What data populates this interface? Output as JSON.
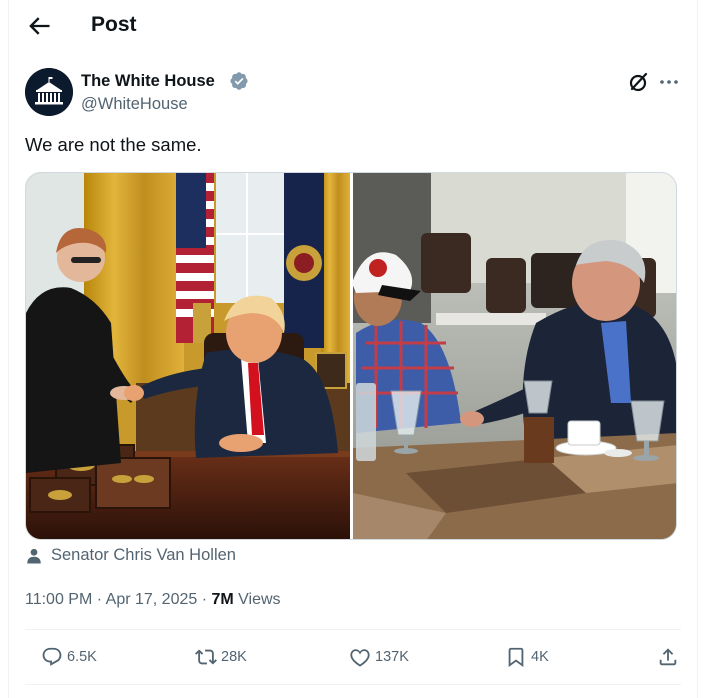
{
  "header": {
    "title": "Post",
    "back_icon": "arrow-left-icon"
  },
  "author": {
    "name": "The White House",
    "handle": "@WhiteHouse",
    "verified_icon": "verified-badge-icon",
    "verified_color": "#829aab"
  },
  "post": {
    "text": "We are not the same."
  },
  "media": {
    "images": [
      {
        "kind": "photo",
        "icon": "photo-oval-office"
      },
      {
        "kind": "photo",
        "icon": "photo-restaurant-meeting"
      }
    ]
  },
  "tag": {
    "icon": "person-icon",
    "text": "Senator Chris Van Hollen"
  },
  "meta": {
    "time": "11:00 PM",
    "sep1": " · ",
    "date": "Apr 17, 2025",
    "sep2": " · ",
    "views_count": "7M",
    "views_label": " Views"
  },
  "actions": {
    "replies": "6.5K",
    "reposts": "28K",
    "likes": "137K",
    "bookmarks": "4K"
  },
  "colors": {
    "text": "#0f1419",
    "secondary": "#536471",
    "border": "#eff3f4"
  }
}
